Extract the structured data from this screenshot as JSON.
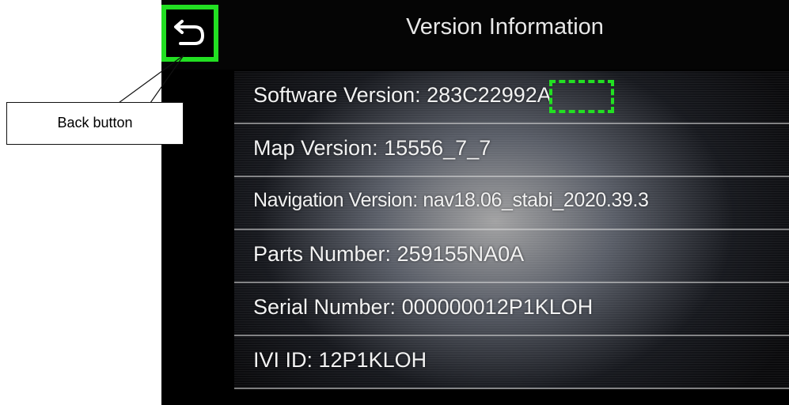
{
  "header": {
    "title": "Version Information"
  },
  "back_button": {
    "icon": "back-arrow-icon",
    "highlight_color": "#22e022"
  },
  "version_list": [
    {
      "label": "Software Version: 283C22992A"
    },
    {
      "label": "Map Version: 15556_7_7"
    },
    {
      "label": "Navigation Version: nav18.06_stabi_2020.39.3"
    },
    {
      "label": "Parts Number: 259155NA0A"
    },
    {
      "label": "Serial Number: 000000012P1KLOH"
    },
    {
      "label": "IVI ID: 12P1KLOH"
    }
  ],
  "annotation": {
    "callout_label": "Back button",
    "highlight_color": "#22e022"
  }
}
